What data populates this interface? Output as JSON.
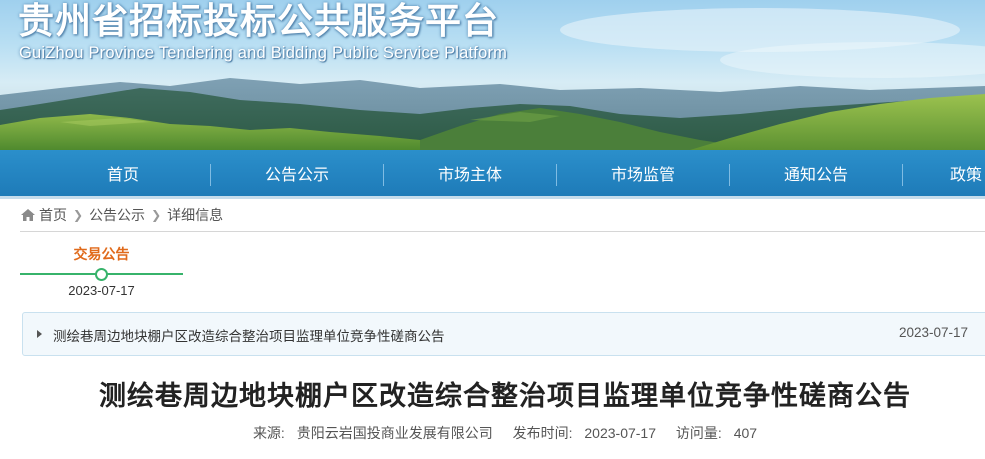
{
  "banner": {
    "title": "贵州省招标投标公共服务平台",
    "subtitle": "GuiZhou Province Tendering and Bidding Public Service Platform"
  },
  "nav": {
    "items": [
      {
        "label": "首页"
      },
      {
        "label": "公告公示"
      },
      {
        "label": "市场主体"
      },
      {
        "label": "市场监管"
      },
      {
        "label": "通知公告"
      },
      {
        "label": "政策"
      }
    ]
  },
  "breadcrumb": {
    "home_icon": "home-icon",
    "items": [
      "首页",
      "公告公示",
      "详细信息"
    ]
  },
  "timeline": {
    "label": "交易公告",
    "date": "2023-07-17",
    "accent": "#37b36b",
    "label_color": "#e06a1b"
  },
  "announcement": {
    "title": "测绘巷周边地块棚户区改造综合整治项目监理单位竞争性磋商公告",
    "date": "2023-07-17"
  },
  "article": {
    "title": "测绘巷周边地块棚户区改造综合整治项目监理单位竞争性磋商公告",
    "source_label": "来源:",
    "source": "贵阳云岩国投商业发展有限公司",
    "publish_label": "发布时间:",
    "publish_time": "2023-07-17",
    "views_label": "访问量:",
    "views": "407"
  },
  "colors": {
    "nav_bg": "#1e7bb8",
    "box_bg": "#f2f8fc"
  }
}
